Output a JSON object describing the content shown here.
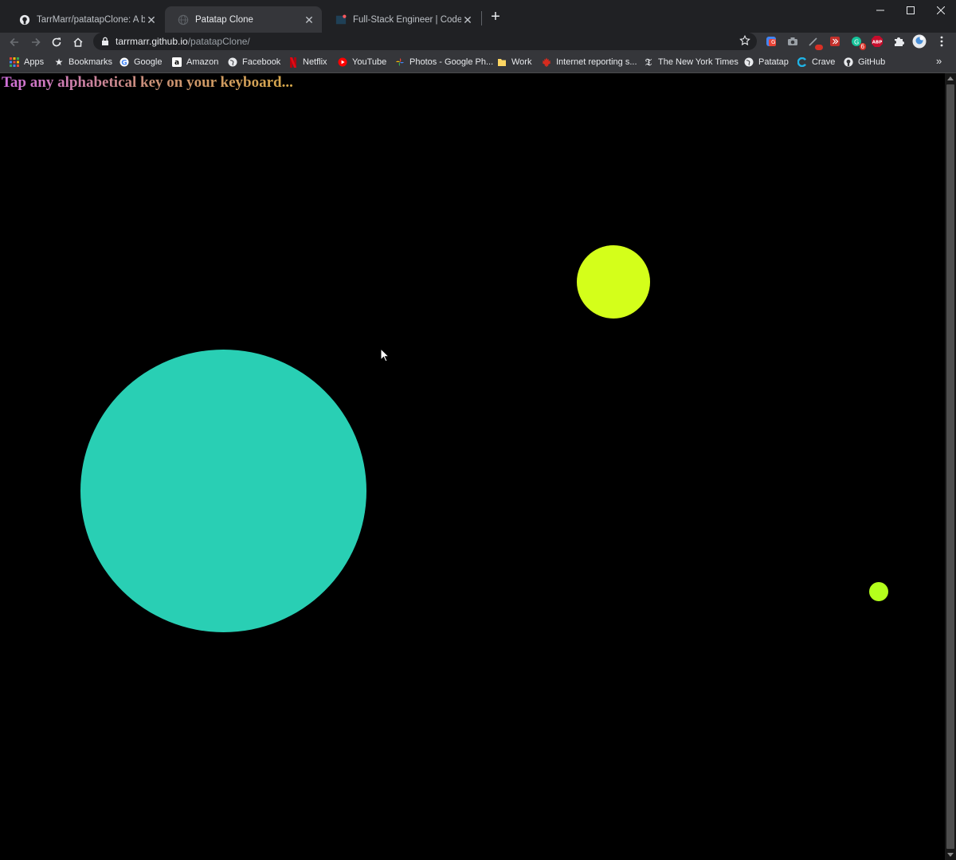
{
  "tabs": [
    {
      "title": "TarrMarr/patatapClone: A basic clone of Patatap",
      "icon": "github-icon",
      "active": false
    },
    {
      "title": "Patatap Clone",
      "icon": "globe-icon",
      "active": true
    },
    {
      "title": "Full-Stack Engineer | Codecademy",
      "icon": "codecademy-icon",
      "active": false
    }
  ],
  "address_bar": {
    "host": "tarrmarr.github.io",
    "path": "/patatapClone/"
  },
  "extensions": [
    {
      "icon": "google-translate-icon"
    },
    {
      "icon": "screenshot-icon"
    },
    {
      "icon": "eyedropper-icon",
      "badge": ""
    },
    {
      "icon": "youtube-ext-icon"
    },
    {
      "icon": "grammarly-icon",
      "badge": "6"
    },
    {
      "icon": "adblock-plus-icon",
      "label": "ABP"
    },
    {
      "icon": "puzzle-icon"
    },
    {
      "icon": "profile-avatar-icon"
    },
    {
      "icon": "kebab-menu-icon"
    }
  ],
  "bookmarks": [
    {
      "label": "Apps",
      "icon": "apps-grid-icon"
    },
    {
      "label": "Bookmarks",
      "icon": "star-icon"
    },
    {
      "label": "Google",
      "icon": "google-icon"
    },
    {
      "label": "Amazon",
      "icon": "amazon-icon"
    },
    {
      "label": "Facebook",
      "icon": "globe-icon"
    },
    {
      "label": "Netflix",
      "icon": "netflix-icon"
    },
    {
      "label": "YouTube",
      "icon": "youtube-icon"
    },
    {
      "label": "Photos - Google Ph...",
      "icon": "google-photos-icon"
    },
    {
      "label": "Work",
      "icon": "folder-icon"
    },
    {
      "label": "Internet reporting s...",
      "icon": "maple-leaf-icon"
    },
    {
      "label": "The New York Times",
      "icon": "nyt-icon"
    },
    {
      "label": "Patatap",
      "icon": "globe-icon"
    },
    {
      "label": "Crave",
      "icon": "crave-icon"
    },
    {
      "label": "GitHub",
      "icon": "github-icon"
    }
  ],
  "page": {
    "heading": "Tap any alphabetical key on your keyboard...",
    "background": "#000000",
    "circles": [
      {
        "color": "#d4ff1a"
      },
      {
        "color": "#29cfb4"
      },
      {
        "color": "#b4ff1c"
      }
    ]
  },
  "colors": {
    "tabstrip": "#202124",
    "toolbar": "#35363a",
    "heading_gradient": [
      "#d06fdc",
      "#c98f78",
      "#d8a94a"
    ]
  }
}
